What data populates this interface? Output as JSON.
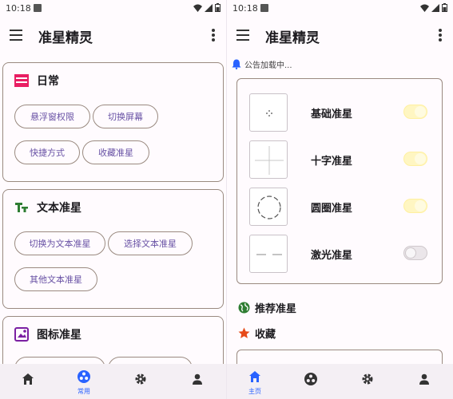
{
  "left": {
    "status": {
      "time": "10:18"
    },
    "appbar": {
      "title": "准星精灵"
    },
    "cards": [
      {
        "title": "日常",
        "icon": "daily-icon",
        "color": "#e91e63",
        "buttons": [
          "悬浮窗权限",
          "切换屏幕",
          "快捷方式",
          "收藏准星"
        ]
      },
      {
        "title": "文本准星",
        "icon": "text-icon",
        "color": "#2e7d32",
        "buttons": [
          "切换为文本准星",
          "选择文本准星",
          "其他文本准星"
        ]
      },
      {
        "title": "图标准星",
        "icon": "image-icon",
        "color": "#7b1fa2",
        "buttons": []
      }
    ],
    "nav": {
      "active": "常用"
    }
  },
  "right": {
    "status": {
      "time": "10:18"
    },
    "appbar": {
      "title": "准星精灵"
    },
    "notice": "公告加载中...",
    "crosshairs": [
      {
        "label": "基础准星",
        "icon": "dot-crosshair-icon",
        "enabled": true
      },
      {
        "label": "十字准星",
        "icon": "cross-crosshair-icon",
        "enabled": true
      },
      {
        "label": "圆圈准星",
        "icon": "circle-crosshair-icon",
        "enabled": true
      },
      {
        "label": "激光准星",
        "icon": "laser-crosshair-icon",
        "enabled": false
      }
    ],
    "sections": {
      "recommended": "推荐准星",
      "favorites": "收藏"
    },
    "nav": {
      "active": "主页"
    }
  },
  "colors": {
    "accent": "#6750a4",
    "nav_active": "#2962ff",
    "outline": "#9a8a80"
  }
}
